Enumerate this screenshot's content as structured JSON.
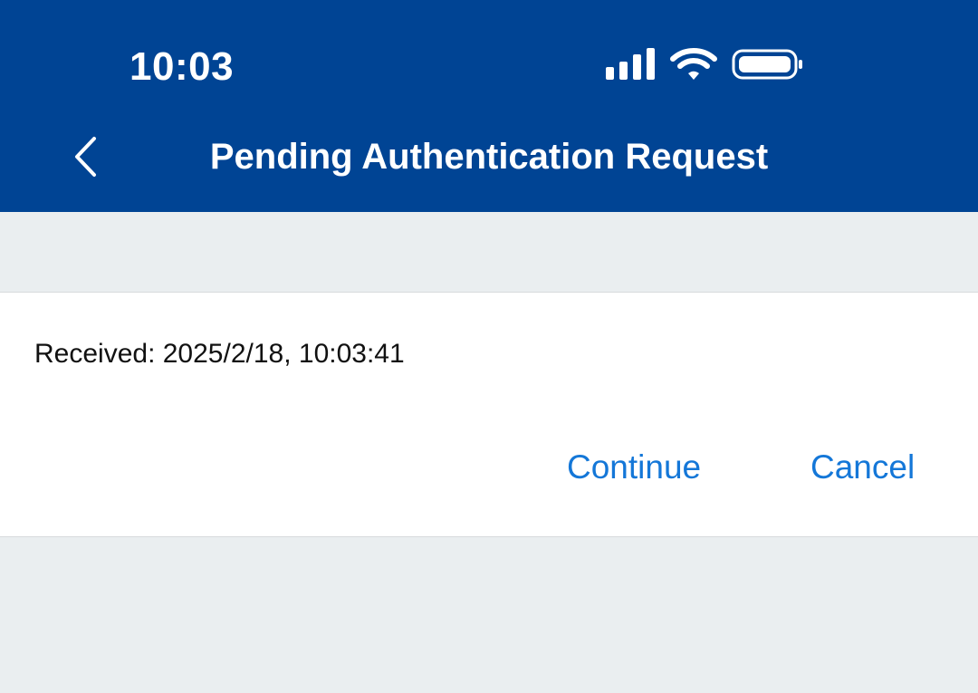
{
  "status_bar": {
    "time": "10:03",
    "icons": [
      "signal-icon",
      "wifi-icon",
      "battery-icon"
    ]
  },
  "header": {
    "title": "Pending Authentication Request",
    "back_icon": "chevron-left-icon",
    "background_color": "#004494"
  },
  "request": {
    "received_label": "Received:",
    "received_time": "2025/2/18, 10:03:41"
  },
  "actions": {
    "continue_label": "Continue",
    "cancel_label": "Cancel",
    "link_color": "#1477D8"
  },
  "colors": {
    "page_background": "#EAEEF0",
    "card_background": "#FFFFFF"
  }
}
